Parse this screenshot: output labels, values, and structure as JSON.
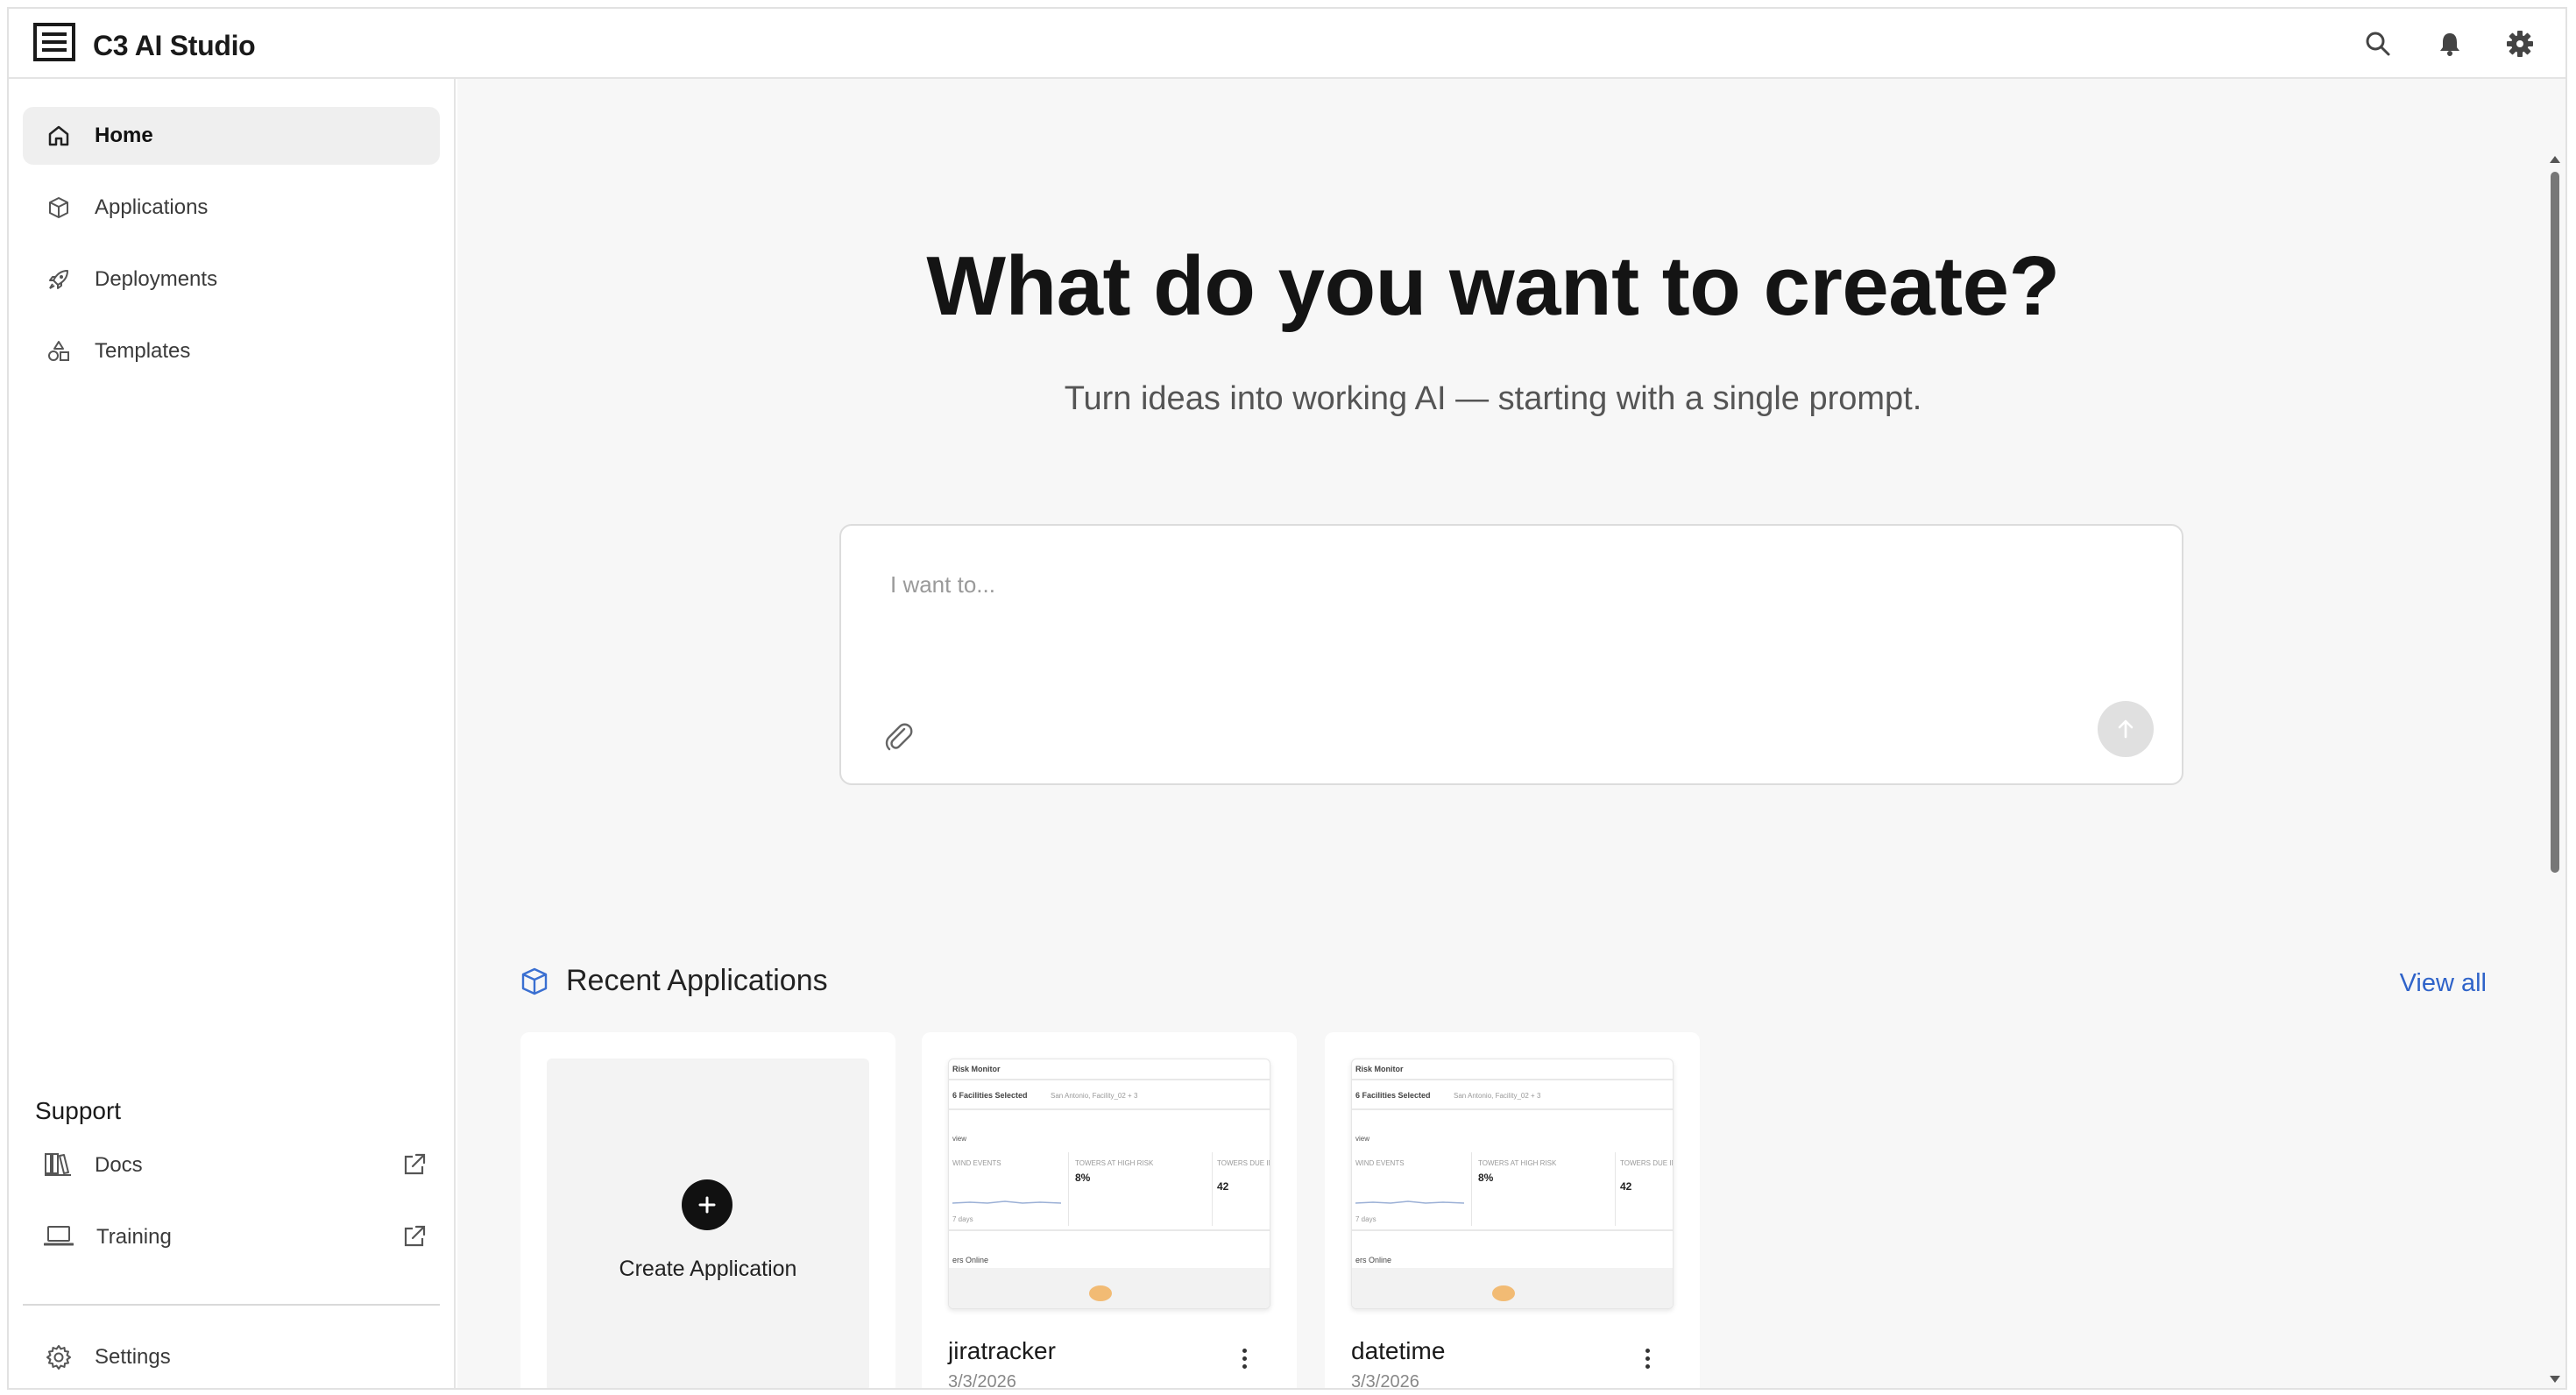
{
  "header": {
    "title": "C3 AI Studio",
    "icons": [
      "search-icon",
      "bell-icon",
      "gear-icon"
    ]
  },
  "sidebar": {
    "items": [
      {
        "label": "Home",
        "icon": "home-icon",
        "active": true
      },
      {
        "label": "Applications",
        "icon": "cube-icon",
        "active": false
      },
      {
        "label": "Deployments",
        "icon": "rocket-icon",
        "active": false
      },
      {
        "label": "Templates",
        "icon": "shapes-icon",
        "active": false
      }
    ],
    "support": {
      "title": "Support",
      "items": [
        {
          "label": "Docs",
          "icon": "books-icon",
          "external": true
        },
        {
          "label": "Training",
          "icon": "laptop-icon",
          "external": true
        }
      ]
    },
    "settings_label": "Settings"
  },
  "main": {
    "hero_title": "What do you want to create?",
    "hero_subtitle": "Turn ideas into working AI — starting with a single prompt.",
    "prompt": {
      "placeholder": "I want to...",
      "value": ""
    },
    "recent": {
      "title": "Recent Applications",
      "view_all": "View all",
      "create_label": "Create Application",
      "apps": [
        {
          "name": "jiratracker",
          "date": "3/3/2026",
          "preview": {
            "title": "Risk Monitor",
            "selected": "6 Facilities Selected",
            "filter": "San Antonio, Facility_02 + 3",
            "view": "view",
            "k1": "WIND EVENTS",
            "k2": "TOWERS AT HIGH RISK",
            "k2v": "8%",
            "k3": "TOWERS DUE INSPECTION",
            "k3v": "42",
            "days": "7 days",
            "online": "ers Online"
          }
        },
        {
          "name": "datetime",
          "date": "3/3/2026",
          "preview": {
            "title": "Risk Monitor",
            "selected": "6 Facilities Selected",
            "filter": "San Antonio, Facility_02 + 3",
            "view": "view",
            "k1": "WIND EVENTS",
            "k2": "TOWERS AT HIGH RISK",
            "k2v": "8%",
            "k3": "TOWERS DUE INSPECTION",
            "k3v": "42",
            "days": "7 days",
            "online": "ers Online"
          }
        }
      ]
    }
  },
  "colors": {
    "accent_link": "#2f63c9",
    "active_bg": "#efefef",
    "main_bg": "#f7f7f7"
  }
}
